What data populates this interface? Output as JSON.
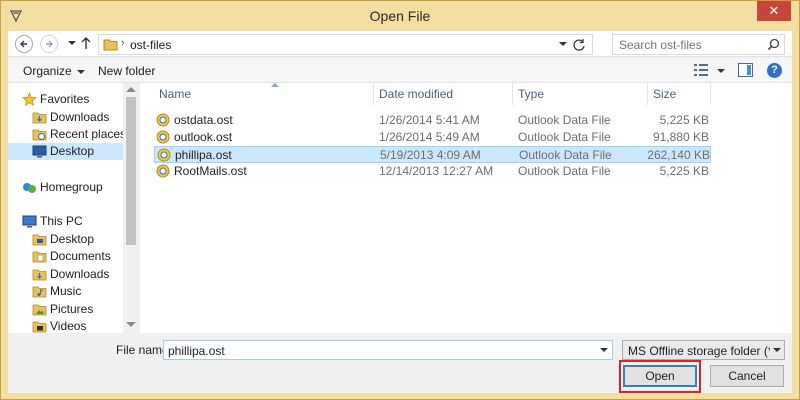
{
  "window": {
    "title": "Open File",
    "close_glyph": "✕"
  },
  "address_bar": {
    "path": "ost-files",
    "chevron": "›",
    "search_placeholder": "Search ost-files"
  },
  "command_bar": {
    "organize": "Organize",
    "new_folder": "New folder",
    "help": "?"
  },
  "nav_pane": {
    "items": [
      {
        "label": "Favorites",
        "icon": "star-icon",
        "indent": 0
      },
      {
        "label": "Downloads",
        "icon": "downloads-folder-icon",
        "indent": 1
      },
      {
        "label": "Recent places",
        "icon": "recent-places-icon",
        "indent": 1
      },
      {
        "label": "Desktop",
        "icon": "desktop-icon",
        "indent": 1,
        "selected": true
      },
      {
        "label": "Homegroup",
        "icon": "homegroup-icon",
        "indent": 0
      },
      {
        "label": "This PC",
        "icon": "computer-icon",
        "indent": 0
      },
      {
        "label": "Desktop",
        "icon": "desktop-folder-icon",
        "indent": 1
      },
      {
        "label": "Documents",
        "icon": "documents-folder-icon",
        "indent": 1
      },
      {
        "label": "Downloads",
        "icon": "downloads-folder-icon",
        "indent": 1
      },
      {
        "label": "Music",
        "icon": "music-folder-icon",
        "indent": 1
      },
      {
        "label": "Pictures",
        "icon": "pictures-folder-icon",
        "indent": 1
      },
      {
        "label": "Videos",
        "icon": "videos-folder-icon",
        "indent": 1
      }
    ]
  },
  "file_list": {
    "columns": [
      "Name",
      "Date modified",
      "Type",
      "Size"
    ],
    "rows": [
      {
        "name": "ostdata.ost",
        "date": "1/26/2014 5:41 AM",
        "type": "Outlook Data File",
        "size": "5,225 KB"
      },
      {
        "name": "outlook.ost",
        "date": "1/26/2014 5:49 AM",
        "type": "Outlook Data File",
        "size": "91,880 KB"
      },
      {
        "name": "phillipa.ost",
        "date": "5/19/2013 4:09 AM",
        "type": "Outlook Data File",
        "size": "262,140 KB",
        "selected": true
      },
      {
        "name": "RootMails.ost",
        "date": "12/14/2013 12:27 AM",
        "type": "Outlook Data File",
        "size": "5,225 KB"
      }
    ]
  },
  "footer": {
    "file_name_label": "File name:",
    "file_name_value": "phillipa.ost",
    "filter": "MS Offline storage folder (*.ost)",
    "open": "Open",
    "cancel": "Cancel"
  },
  "colors": {
    "frame": "#f3dea2",
    "close": "#c7453a",
    "selection": "#cce8ff",
    "highlight": "#e0202a"
  }
}
